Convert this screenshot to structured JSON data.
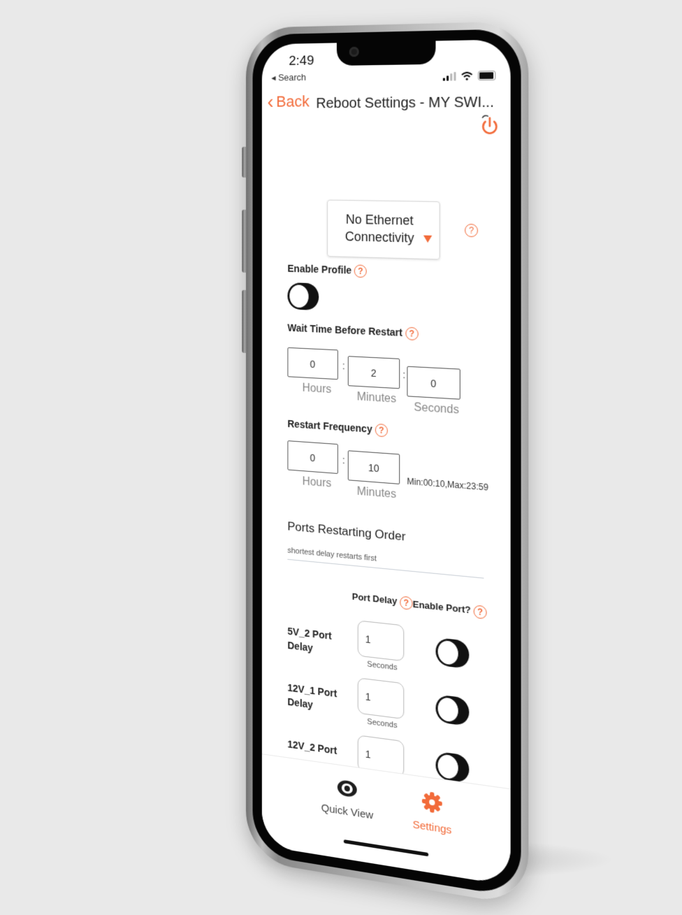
{
  "status_bar": {
    "time": "2:49",
    "back_to_app": "Search",
    "icons": [
      "cellular-signal-icon",
      "wifi-icon",
      "battery-icon"
    ]
  },
  "nav": {
    "back_label": "Back",
    "title": "Reboot Settings - MY SWI...",
    "action_icon": "power-restart-icon"
  },
  "profile": {
    "selected": "No Ethernet Connectivity",
    "enable_label": "Enable Profile",
    "enabled": false
  },
  "wait_time": {
    "label": "Wait Time Before Restart",
    "hours": "0",
    "minutes": "2",
    "seconds": "0",
    "hours_label": "Hours",
    "minutes_label": "Minutes",
    "seconds_label": "Seconds",
    "separator": ":"
  },
  "frequency": {
    "label": "Restart Frequency",
    "hours": "0",
    "minutes": "10",
    "hours_label": "Hours",
    "minutes_label": "Minutes",
    "range": "Min:00:10,Max:23:59",
    "separator": ":"
  },
  "ports": {
    "title": "Ports Restarting Order",
    "hint": "shortest delay restarts first",
    "col_delay": "Port Delay",
    "col_enable": "Enable Port?",
    "unit": "Seconds",
    "rows": [
      {
        "label": "5V_2 Port Delay",
        "delay": "1",
        "enabled": false
      },
      {
        "label": "12V_1 Port Delay",
        "delay": "1",
        "enabled": false
      },
      {
        "label": "12V_2 Port",
        "delay": "1",
        "enabled": false
      }
    ]
  },
  "help_glyph": "?",
  "tabs": [
    {
      "label": "Quick View",
      "icon": "eye-icon",
      "active": false
    },
    {
      "label": "Settings",
      "icon": "gear-icon",
      "active": true
    }
  ],
  "colors": {
    "accent": "#f26b3a",
    "text": "#222222",
    "inactive_tab": "#444444"
  }
}
